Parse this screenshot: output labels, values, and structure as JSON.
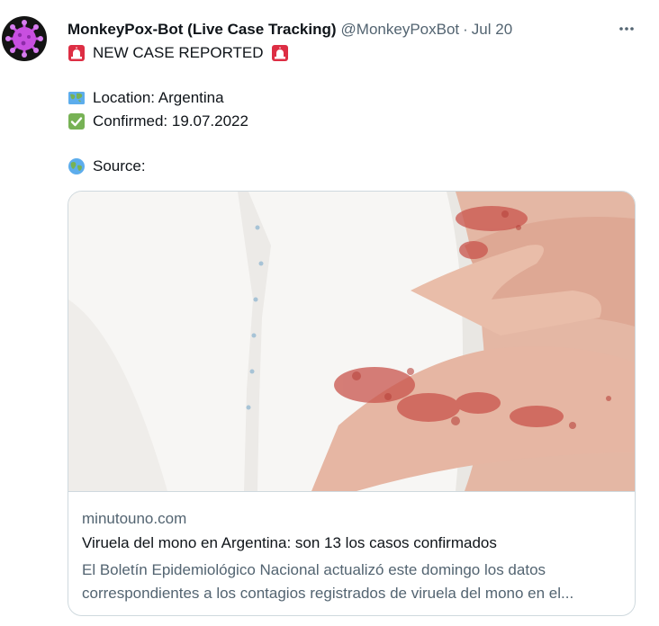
{
  "tweet": {
    "display_name": "MonkeyPox-Bot (Live Case Tracking)",
    "handle": "@MonkeyPoxBot",
    "separator": "·",
    "date": "Jul 20",
    "lines": {
      "new_case": "NEW CASE REPORTED",
      "location": "Location: Argentina",
      "confirmed": "Confirmed: 19.07.2022",
      "source": "Source:"
    },
    "icons": {
      "siren": "rotating-light-icon",
      "map": "world-map-icon",
      "check": "check-mark-button-icon",
      "globe": "globe-icon",
      "more": "more-options-icon"
    }
  },
  "card": {
    "domain": "minutouno.com",
    "title": "Viruela del mono en Argentina: son 13 los casos confirmados",
    "description": "El Boletín Epidemiológico Nacional actualizó este domingo los datos correspondientes a los contagios registrados de viruela del mono en el..."
  },
  "colors": {
    "text_primary": "#0f1419",
    "text_secondary": "#536471",
    "border": "#cfd9de",
    "avatar_bg": "#141414",
    "avatar_virus": "#c84fe0"
  }
}
